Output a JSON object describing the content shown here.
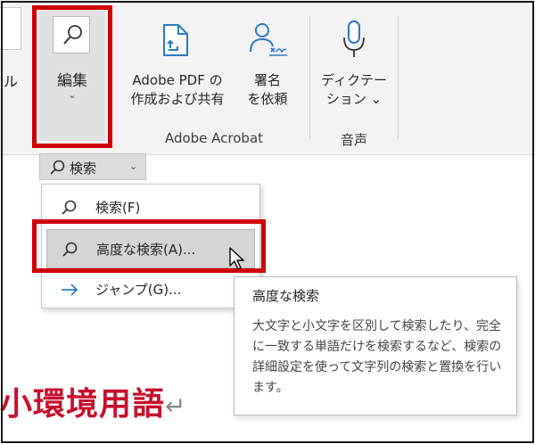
{
  "ribbon": {
    "cut_label": "ル",
    "edit": {
      "label": "編集",
      "chevron": "⌄"
    },
    "adobe_pdf": {
      "line1": "Adobe PDF の",
      "line2": "作成および共有"
    },
    "signature": {
      "line1": "署名",
      "line2": "を依頼"
    },
    "acrobat_group_label": "Adobe Acrobat",
    "dictation": {
      "line1": "ディクテー",
      "line2": "ション ⌄"
    },
    "voice_group_label": "音声"
  },
  "find_split": {
    "label": "検索",
    "chevron": "⌄"
  },
  "menu": {
    "items": [
      {
        "label": "検索(F)",
        "icon": "search-icon"
      },
      {
        "label": "高度な検索(A)...",
        "icon": "search-icon"
      },
      {
        "label": "ジャンプ(G)...",
        "icon": "arrow-right-icon"
      }
    ]
  },
  "tooltip": {
    "title": "高度な検索",
    "body": "大文字と小文字を区別して検索したり、完全に一致する単語だけを検索するなど、検索の詳細設定を使って文字列の検索と置換を行います。"
  },
  "document": {
    "text": "小環境用語",
    "return_mark": "↵"
  },
  "colors": {
    "highlight_frame": "#d10000",
    "doc_text": "#c8102e",
    "accent_icon": "#2b79c2"
  }
}
